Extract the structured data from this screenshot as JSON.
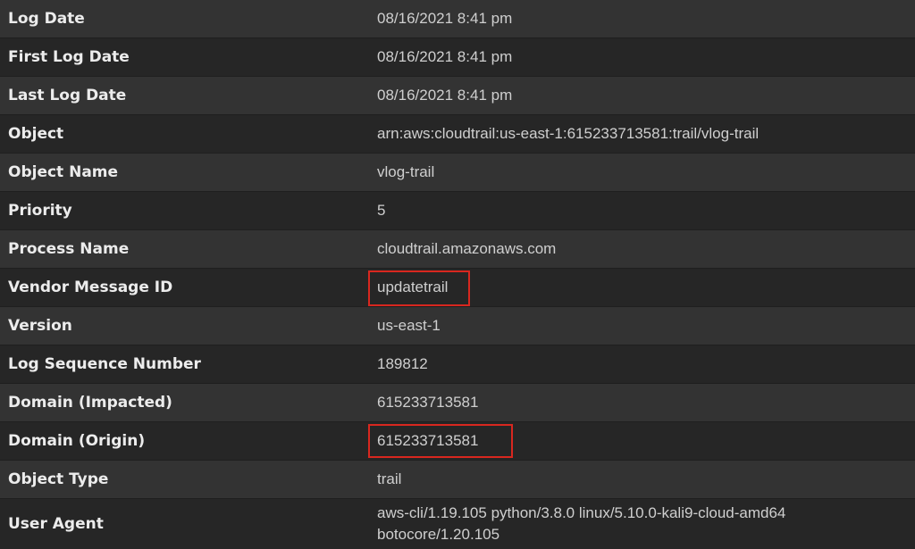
{
  "rows": [
    {
      "key": "Log Date",
      "value": "08/16/2021 8:41 pm"
    },
    {
      "key": "First Log Date",
      "value": "08/16/2021 8:41 pm"
    },
    {
      "key": "Last Log Date",
      "value": "08/16/2021 8:41 pm"
    },
    {
      "key": "Object",
      "value": "arn:aws:cloudtrail:us-east-1:615233713581:trail/vlog-trail"
    },
    {
      "key": "Object Name",
      "value": "vlog-trail"
    },
    {
      "key": "Priority",
      "value": "5"
    },
    {
      "key": "Process Name",
      "value": "cloudtrail.amazonaws.com"
    },
    {
      "key": "Vendor Message ID",
      "value": "updatetrail"
    },
    {
      "key": "Version",
      "value": "us-east-1"
    },
    {
      "key": "Log Sequence Number",
      "value": "189812"
    },
    {
      "key": "Domain (Impacted)",
      "value": "615233713581"
    },
    {
      "key": "Domain (Origin)",
      "value": "615233713581"
    },
    {
      "key": "Object Type",
      "value": "trail"
    },
    {
      "key": "User Agent",
      "value_line1": "aws-cli/1.19.105 python/3.8.0 linux/5.10.0-kali9-cloud-amd64",
      "value_line2": "botocore/1.20.105"
    }
  ],
  "colors": {
    "highlight_box": "#d8271f",
    "row_odd": "#333333",
    "row_even": "#262626"
  }
}
